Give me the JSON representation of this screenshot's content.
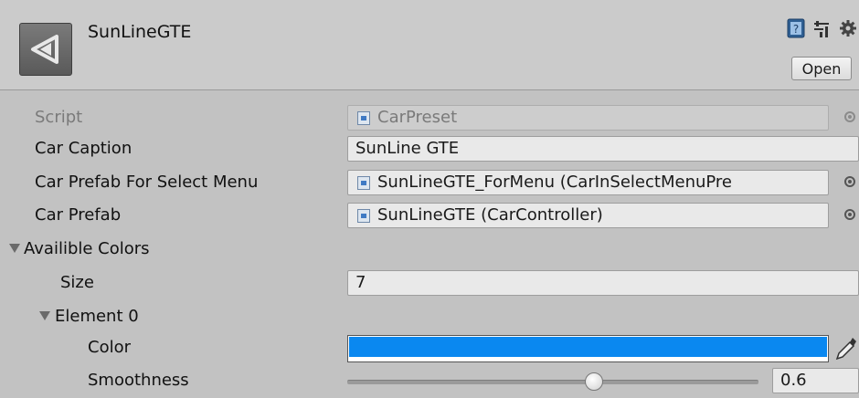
{
  "header": {
    "title": "SunLineGTE",
    "open_label": "Open",
    "icons": [
      "help-book-icon",
      "preset-sliders-icon",
      "gear-icon"
    ],
    "logo": "unity-logo"
  },
  "fields": {
    "script": {
      "label": "Script",
      "value": "CarPreset"
    },
    "car_caption": {
      "label": "Car Caption",
      "value": "SunLine GTE"
    },
    "car_prefab_menu": {
      "label": "Car Prefab For Select Menu",
      "value": "SunLineGTE_ForMenu (CarInSelectMenuPre"
    },
    "car_prefab": {
      "label": "Car Prefab",
      "value": "SunLineGTE (CarController)"
    },
    "colors": {
      "label": "Availible Colors"
    },
    "size": {
      "label": "Size",
      "value": "7"
    },
    "element0": {
      "label": "Element 0"
    },
    "color": {
      "label": "Color",
      "value": "#0a88f0"
    },
    "smoothness": {
      "label": "Smoothness",
      "value": "0.6",
      "fraction": 0.6
    }
  }
}
